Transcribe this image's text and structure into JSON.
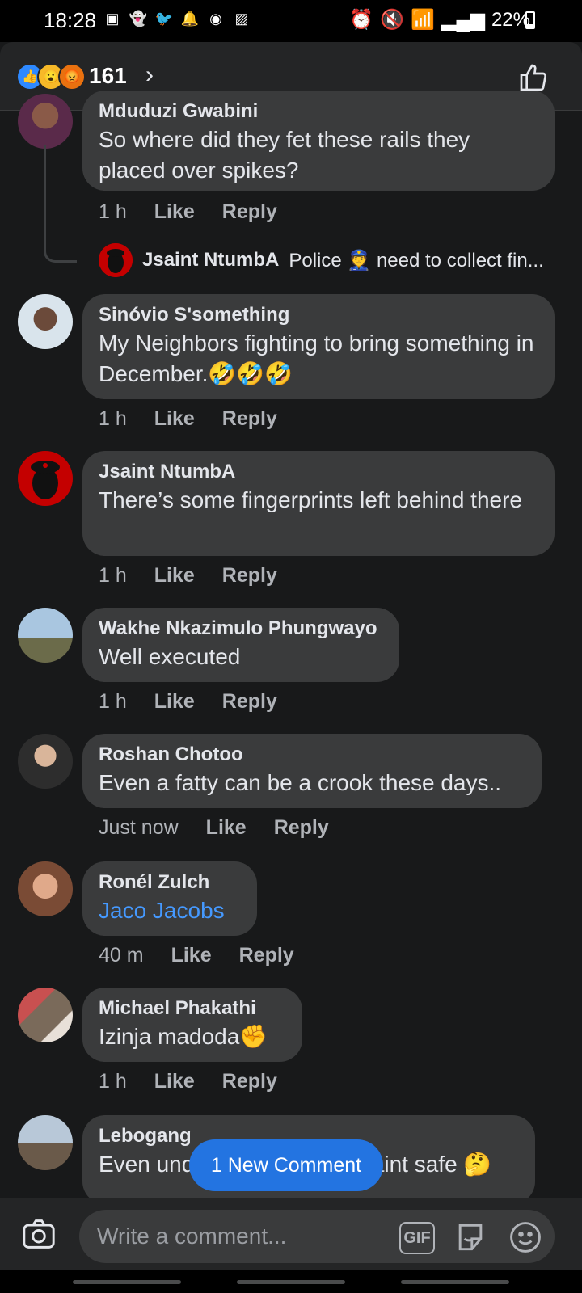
{
  "status_bar": {
    "time": "18:28",
    "battery": "22%"
  },
  "reactions": {
    "count": "161"
  },
  "comments": [
    {
      "author": "Mduduzi Gwabini",
      "text": "So where did they fet these rails they placed over spikes?",
      "time": "1 h",
      "like": "Like",
      "reply": "Reply"
    },
    {
      "author": "Sinóvio S'something",
      "text": "My Neighbors fighting to bring something in December.🤣🤣🤣",
      "time": "1 h",
      "like": "Like",
      "reply": "Reply"
    },
    {
      "author": "Jsaint NtumbA",
      "text": "There’s some fingerprints left behind there",
      "time": "1 h",
      "like": "Like",
      "reply": "Reply"
    },
    {
      "author": "Wakhe Nkazimulo Phungwayo",
      "text": "Well executed",
      "time": "1 h",
      "like": "Like",
      "reply": "Reply"
    },
    {
      "author": "Roshan Chotoo",
      "text": "Even a fatty can be a crook these days..",
      "time": "Just now",
      "like": "Like",
      "reply": "Reply"
    },
    {
      "author": "Ronél Zulch",
      "text": "Jaco Jacobs",
      "time": "40 m",
      "like": "Like",
      "reply": "Reply"
    },
    {
      "author": "Michael Phakathi",
      "text": "Izinja madoda✊",
      "time": "1 h",
      "like": "Like",
      "reply": "Reply"
    },
    {
      "author": "Lebogang",
      "text": "Even underground parking aint safe 🤔"
    }
  ],
  "reply_preview": {
    "author": "Jsaint NtumbA",
    "text": "Police 👮 need to collect fin..."
  },
  "new_comment_button": "1 New Comment",
  "composer": {
    "placeholder": "Write a comment...",
    "gif": "GIF"
  }
}
